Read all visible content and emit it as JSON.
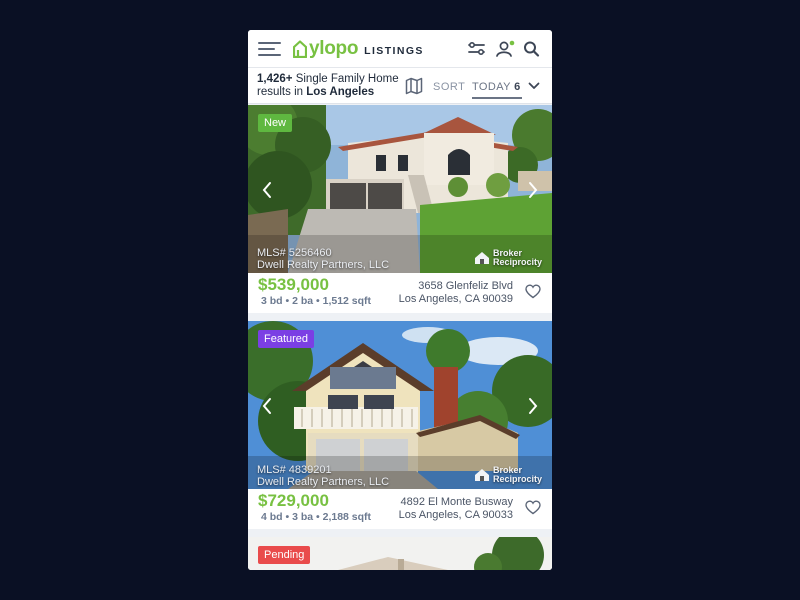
{
  "header": {
    "logo_text": "ylopo",
    "logo_sub": "LISTINGS",
    "brand_color": "#78c142",
    "icons": [
      "menu-icon",
      "filter-icon",
      "user-icon",
      "search-icon"
    ]
  },
  "results": {
    "count": "1,426+",
    "type_text": " Single Family Home",
    "line2_prefix": "results in ",
    "city": "Los Angeles",
    "sort_label": "SORT",
    "today_label": "TODAY",
    "today_count": "6"
  },
  "listings": [
    {
      "badge": "New",
      "badge_color": "#5fb840",
      "mls": "MLS# 5256460",
      "broker_name": "Dwell Realty Partners, LLC",
      "broker_logo": [
        "Broker",
        "Reciprocity"
      ],
      "price": "$539,000",
      "specs": "3 bd • 2 ba • 1,512 sqft",
      "address_line1": "3658 Glenfeliz Blvd",
      "address_line2": "Los Angeles, CA 90039"
    },
    {
      "badge": "Featured",
      "badge_color": "#7b3fe4",
      "mls": "MLS# 4839201",
      "broker_name": "Dwell Realty Partners, LLC",
      "broker_logo": [
        "Broker",
        "Reciprocity"
      ],
      "price": "$729,000",
      "specs": "4 bd • 3 ba • 2,188 sqft",
      "address_line1": "4892 El Monte Busway",
      "address_line2": "Los Angeles, CA 90033"
    },
    {
      "badge": "Pending",
      "badge_color": "#e94b4b"
    }
  ]
}
